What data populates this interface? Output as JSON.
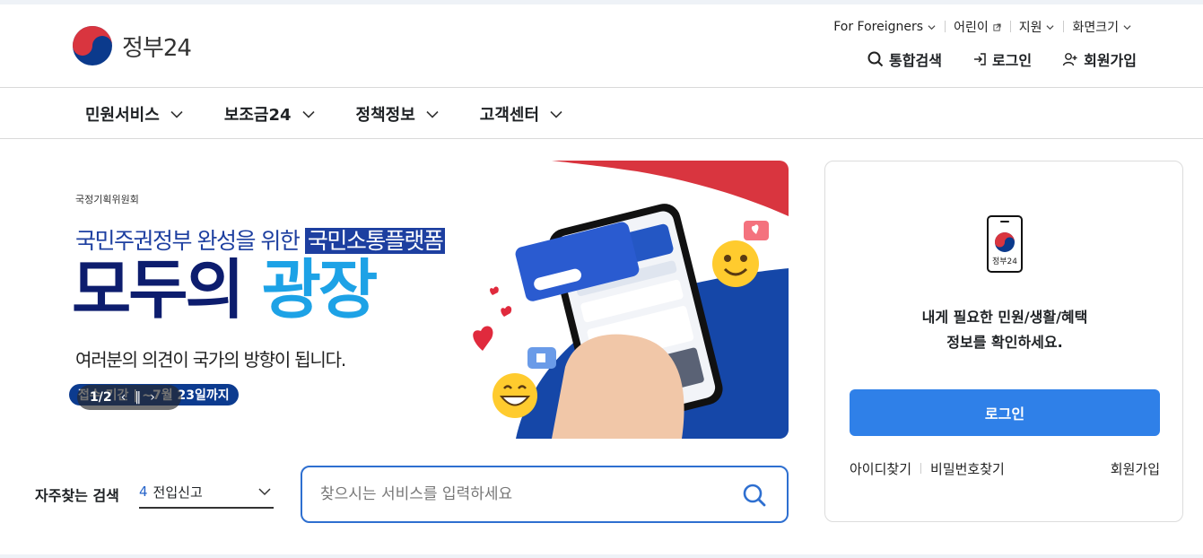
{
  "header": {
    "logo_text": "정부24",
    "util_links": [
      "For Foreigners",
      "어린이",
      "지원",
      "화면크기"
    ],
    "account": [
      "통합검색",
      "로그인",
      "회원가입"
    ]
  },
  "gnb": [
    "민원서비스",
    "보조금24",
    "정책정보",
    "고객센터"
  ],
  "banner": {
    "org": "국정기획위원회",
    "subtitle_a": "국민주권정부 완성을 위한 ",
    "subtitle_b": "국민소통플랫폼",
    "title_a": "모두의 ",
    "title_b": "광장",
    "desc": "여러분의 의견이 국가의 방향이 됩니다.",
    "period": "접수 기간 | ~7월 23일까지",
    "pager": "1/2"
  },
  "favorites": {
    "label": "자주찾는 검색",
    "num": "4",
    "selected": "전입신고"
  },
  "search": {
    "placeholder": "찾으시는 서비스를 입력하세요"
  },
  "login_card": {
    "phone_text": "정부24",
    "msg1": "내게 필요한 민원/생활/혜택",
    "msg2": "정보를 확인하세요.",
    "button": "로그인",
    "find_id": "아이디찾기",
    "find_pw": "비밀번호찾기",
    "join": "회원가입"
  },
  "colors": {
    "accent": "#2f80e8",
    "navy": "#0d1d6e",
    "sky": "#1da2e6",
    "red": "#d9353f"
  }
}
